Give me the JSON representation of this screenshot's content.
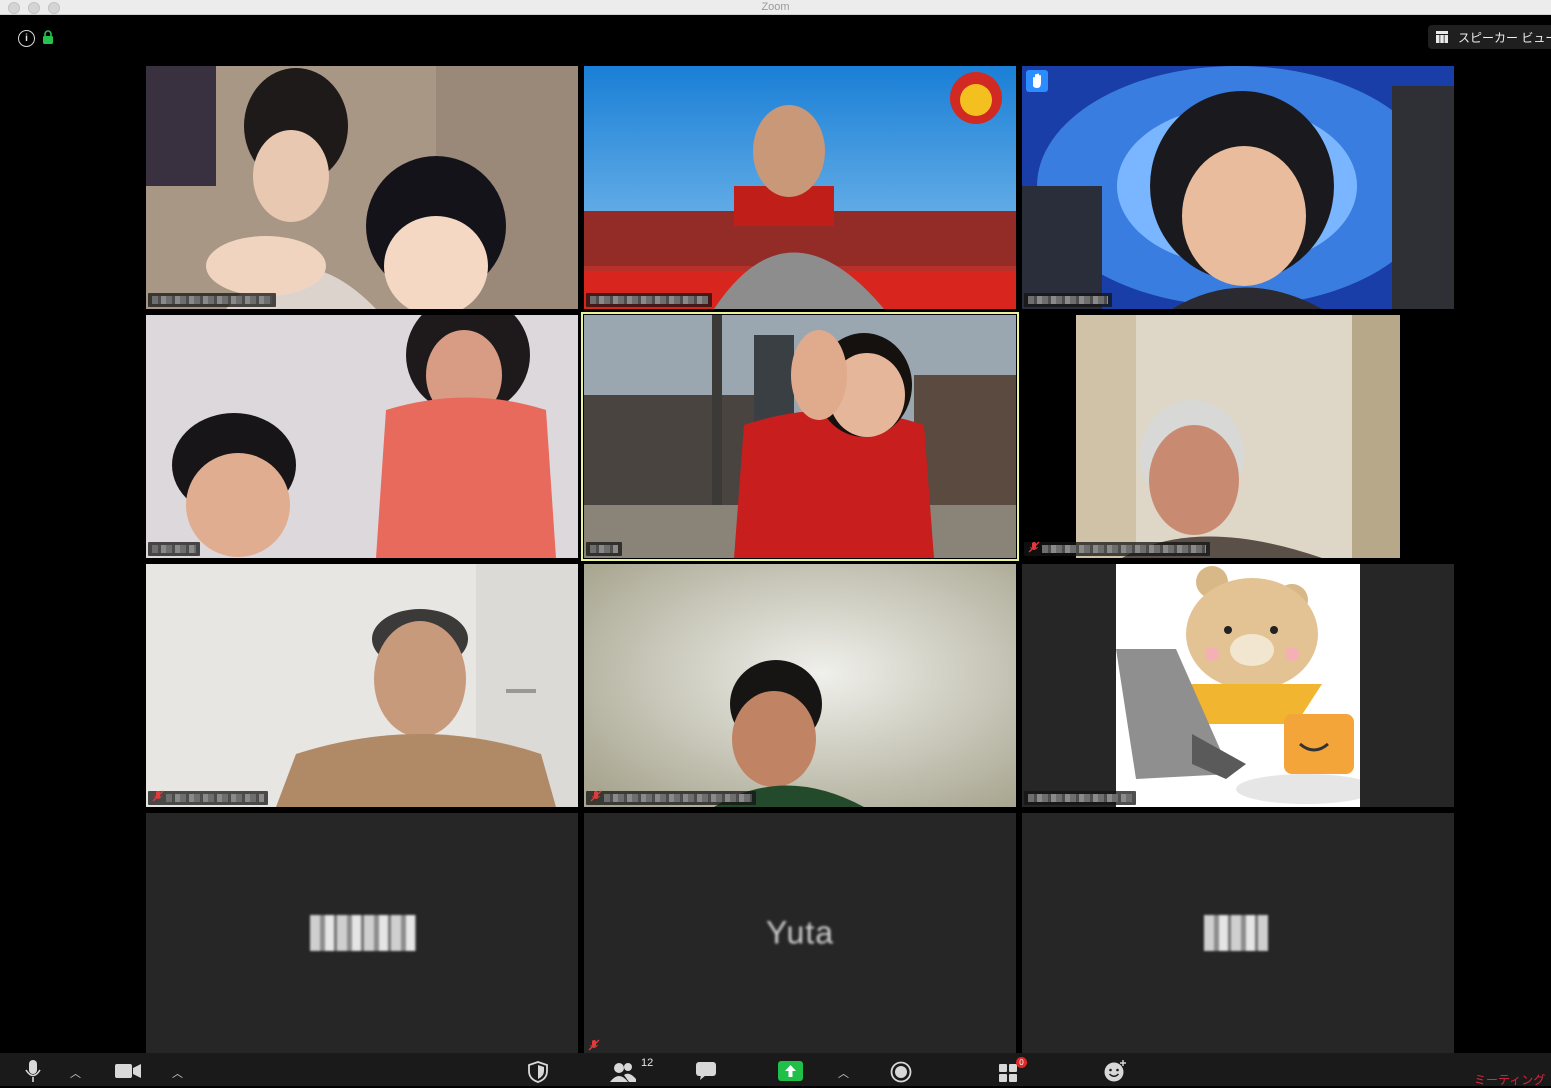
{
  "window": {
    "title": "Zoom"
  },
  "header": {
    "view_toggle_label": "スピーカー ビュー"
  },
  "tiles": [
    {
      "id": "tile-1",
      "name_visible": false,
      "muted": false
    },
    {
      "id": "tile-2",
      "name_visible": false,
      "muted": false
    },
    {
      "id": "tile-3",
      "name_visible": false,
      "muted": false,
      "hand_raised": true
    },
    {
      "id": "tile-4",
      "name_visible": false,
      "muted": false
    },
    {
      "id": "tile-5",
      "name_visible": false,
      "muted": false,
      "active_speaker": true
    },
    {
      "id": "tile-6",
      "name_visible": false,
      "muted": true
    },
    {
      "id": "tile-7",
      "name_visible": false,
      "muted": true
    },
    {
      "id": "tile-8",
      "name_visible": false,
      "muted": true
    },
    {
      "id": "tile-9",
      "name_visible": false,
      "muted": false
    },
    {
      "id": "tile-10",
      "camera_off": true,
      "name_visible": false
    },
    {
      "id": "tile-11",
      "camera_off": true,
      "display_name": "Yuta"
    },
    {
      "id": "tile-12",
      "camera_off": true,
      "name_visible": false,
      "muted": true
    }
  ],
  "toolbar": {
    "participants_count": "12",
    "apps_badge": "0",
    "end_label": "ミーティング",
    "icons": [
      "microphone-icon",
      "camera-icon",
      "security-icon",
      "participants-icon",
      "chat-icon",
      "share-screen-icon",
      "record-icon",
      "apps-icon",
      "reactions-icon"
    ]
  },
  "colors": {
    "share_green": "#1fbf4a",
    "raise_hand_blue": "#2d8cff",
    "end_red": "#e0253d",
    "active_speaker_border": "#e8f39a"
  }
}
